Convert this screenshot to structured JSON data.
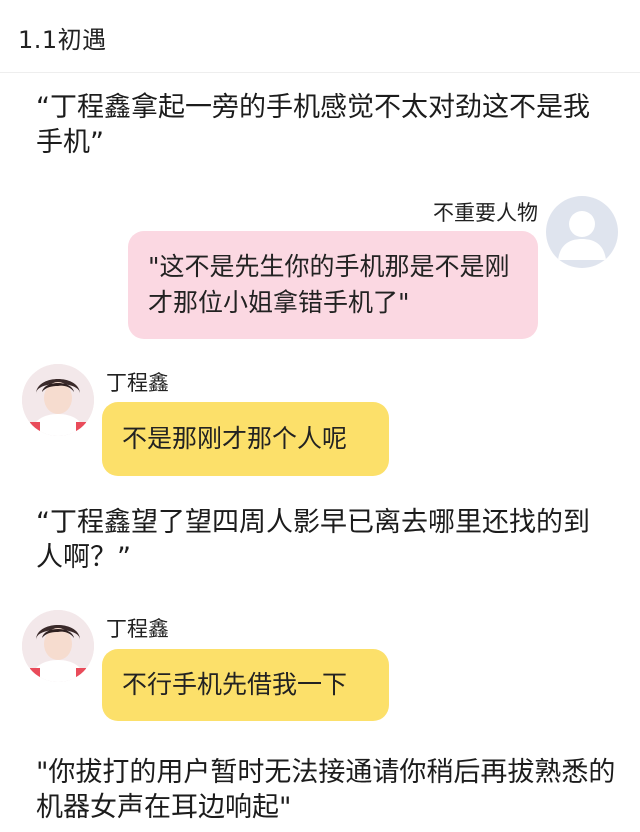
{
  "header": {
    "title": "1.1初遇"
  },
  "narration": [
    "“丁程鑫拿起一旁的手机感觉不太对劲这不是我手机”",
    "“丁程鑫望了望四周人影早已离去哪里还找的到人啊？”",
    "\"你拔打的用户暂时无法接通请你稍后再拔熟悉的机器女声在耳边响起\""
  ],
  "messages": [
    {
      "sender": "不重要人物",
      "text": "\"这不是先生你的手机那是不是刚才那位小姐拿错手机了\"",
      "side": "right",
      "bubble_color": "#fbd8e2",
      "avatar": "default-user-icon"
    },
    {
      "sender": "丁程鑫",
      "text": "不是那刚才那个人呢",
      "side": "left",
      "bubble_color": "#fce06a",
      "avatar": "profile-photo"
    },
    {
      "sender": "丁程鑫",
      "text": "不行手机先借我一下",
      "side": "left",
      "bubble_color": "#fce06a",
      "avatar": "profile-photo"
    }
  ]
}
